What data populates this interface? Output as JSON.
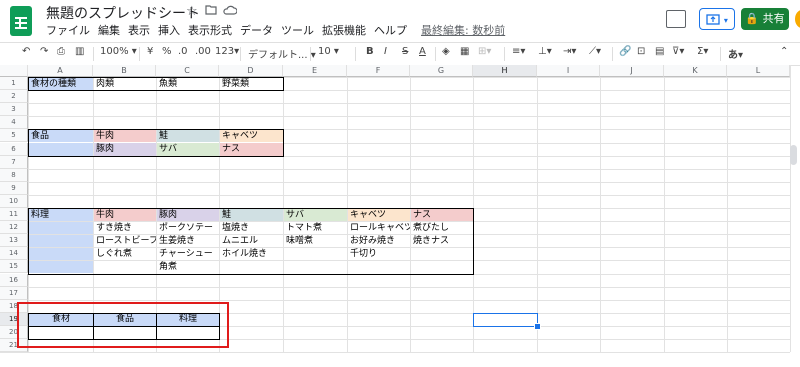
{
  "app": {
    "doc_title": "無題のスプレッドシート",
    "title_icons": [
      "star-icon",
      "move-to-folder-icon",
      "cloud-status-icon"
    ],
    "menu": [
      "ファイル",
      "編集",
      "表示",
      "挿入",
      "表示形式",
      "データ",
      "ツール",
      "拡張機能",
      "ヘルプ"
    ],
    "last_edit": "最終編集: 数秒前",
    "share_label": "共有",
    "lock_icon": "lock-icon"
  },
  "toolbar": {
    "zoom": "100%",
    "currency": "¥",
    "percent": "%",
    "dec_decrease": ".0",
    "dec_increase": ".00",
    "format_more": "123",
    "font": "デフォルト...",
    "font_size": "10",
    "bold": "B",
    "italic": "I",
    "strike": "S",
    "text_color": "A",
    "input_tools": "あ"
  },
  "sheet": {
    "columns": [
      "A",
      "B",
      "C",
      "D",
      "E",
      "F",
      "G",
      "H",
      "I",
      "J",
      "K",
      "L"
    ],
    "rows": [
      "1",
      "2",
      "3",
      "4",
      "5",
      "6",
      "7",
      "8",
      "9",
      "10",
      "11",
      "12",
      "13",
      "14",
      "15",
      "16",
      "17",
      "18",
      "19",
      "20",
      "21"
    ],
    "cells": [
      {
        "id": "A1",
        "text": "食材の種類",
        "bg": "#c9daf8"
      },
      {
        "id": "B1",
        "text": "肉類"
      },
      {
        "id": "C1",
        "text": "魚類"
      },
      {
        "id": "D1",
        "text": "野菜類"
      },
      {
        "id": "A5",
        "text": "食品",
        "bg": "#c9daf8"
      },
      {
        "id": "B5",
        "text": "牛肉",
        "bg": "#f4cccc"
      },
      {
        "id": "C5",
        "text": "鮭",
        "bg": "#d0e0e3"
      },
      {
        "id": "D5",
        "text": "キャベツ",
        "bg": "#fce5cd"
      },
      {
        "id": "A6",
        "text": "",
        "bg": "#c9daf8"
      },
      {
        "id": "B6",
        "text": "豚肉",
        "bg": "#d9d2e9"
      },
      {
        "id": "C6",
        "text": "サバ",
        "bg": "#d9ead3"
      },
      {
        "id": "D6",
        "text": "ナス",
        "bg": "#f4cccc"
      },
      {
        "id": "A11",
        "text": "料理",
        "bg": "#c9daf8"
      },
      {
        "id": "B11",
        "text": "牛肉",
        "bg": "#f4cccc"
      },
      {
        "id": "C11",
        "text": "豚肉",
        "bg": "#d9d2e9"
      },
      {
        "id": "D11",
        "text": "鮭",
        "bg": "#d0e0e3"
      },
      {
        "id": "E11",
        "text": "サバ",
        "bg": "#d9ead3"
      },
      {
        "id": "F11",
        "text": "キャベツ",
        "bg": "#fce5cd"
      },
      {
        "id": "G11",
        "text": "ナス",
        "bg": "#f4cccc"
      },
      {
        "id": "A12",
        "text": "",
        "bg": "#c9daf8"
      },
      {
        "id": "B12",
        "text": "すき焼き"
      },
      {
        "id": "C12",
        "text": "ポークソテー"
      },
      {
        "id": "D12",
        "text": "塩焼き"
      },
      {
        "id": "E12",
        "text": "トマト煮"
      },
      {
        "id": "F12",
        "text": "ロールキャベツ"
      },
      {
        "id": "G12",
        "text": "煮びたし"
      },
      {
        "id": "A13",
        "text": "",
        "bg": "#c9daf8"
      },
      {
        "id": "B13",
        "text": "ローストビーフ"
      },
      {
        "id": "C13",
        "text": "生姜焼き"
      },
      {
        "id": "D13",
        "text": "ムニエル"
      },
      {
        "id": "E13",
        "text": "味噌煮"
      },
      {
        "id": "F13",
        "text": "お好み焼き"
      },
      {
        "id": "G13",
        "text": "焼きナス"
      },
      {
        "id": "A14",
        "text": "",
        "bg": "#c9daf8"
      },
      {
        "id": "B14",
        "text": "しぐれ煮"
      },
      {
        "id": "C14",
        "text": "チャーシュー"
      },
      {
        "id": "D14",
        "text": "ホイル焼き"
      },
      {
        "id": "F14",
        "text": "千切り"
      },
      {
        "id": "A15",
        "text": "",
        "bg": "#c9daf8"
      },
      {
        "id": "C15",
        "text": "角煮"
      },
      {
        "id": "A19",
        "text": "食材",
        "bg": "#c9daf8",
        "align": "center"
      },
      {
        "id": "B19",
        "text": "食品",
        "bg": "#c9daf8",
        "align": "center"
      },
      {
        "id": "C19",
        "text": "料理",
        "bg": "#c9daf8",
        "align": "center"
      }
    ],
    "selected_cell": "H19",
    "highlight_color": "#e01b1b"
  }
}
